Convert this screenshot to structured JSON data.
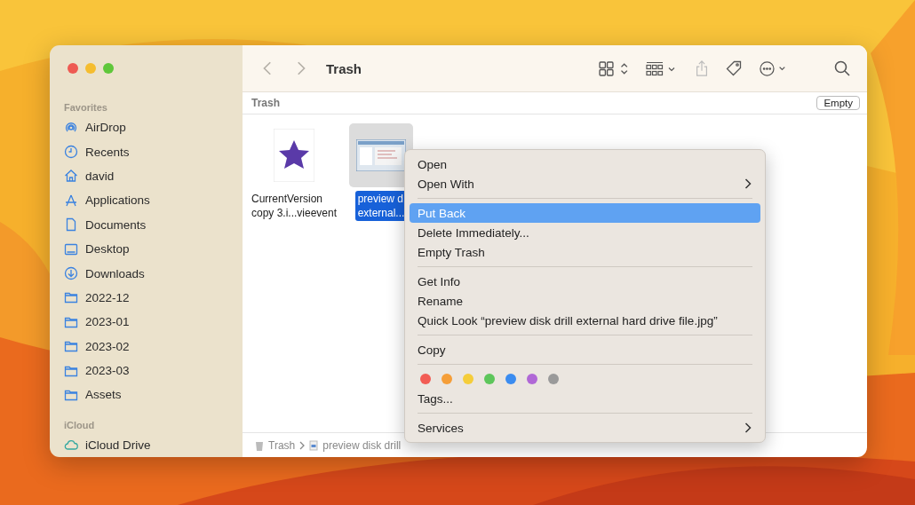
{
  "window": {
    "title": "Trash"
  },
  "sidebar": {
    "sections": [
      {
        "heading": "Favorites",
        "items": [
          {
            "label": "AirDrop",
            "kind": "airdrop"
          },
          {
            "label": "Recents",
            "kind": "clock"
          },
          {
            "label": "david",
            "kind": "home"
          },
          {
            "label": "Applications",
            "kind": "apps"
          },
          {
            "label": "Documents",
            "kind": "doc"
          },
          {
            "label": "Desktop",
            "kind": "desktop"
          },
          {
            "label": "Downloads",
            "kind": "download"
          },
          {
            "label": "2022-12",
            "kind": "folder"
          },
          {
            "label": "2023-01",
            "kind": "folder"
          },
          {
            "label": "2023-02",
            "kind": "folder"
          },
          {
            "label": "2023-03",
            "kind": "folder"
          },
          {
            "label": "Assets",
            "kind": "folder"
          }
        ]
      },
      {
        "heading": "iCloud",
        "items": [
          {
            "label": "iCloud Drive",
            "kind": "cloud"
          }
        ]
      }
    ]
  },
  "location_bar": {
    "title": "Trash",
    "button": "Empty"
  },
  "files": [
    {
      "kind": "star",
      "lines": [
        "CurrentVersion",
        "copy 3.i...vieevent"
      ],
      "selected": false
    },
    {
      "kind": "screenshot",
      "lines": [
        "preview d",
        "external..."
      ],
      "selected": true
    }
  ],
  "path_bar": [
    "Trash",
    "preview disk drill"
  ],
  "context_menu": {
    "groups": [
      [
        {
          "label": "Open",
          "submenu": false,
          "selected": false
        },
        {
          "label": "Open With",
          "submenu": true,
          "selected": false
        }
      ],
      [
        {
          "label": "Put Back",
          "submenu": false,
          "selected": true
        },
        {
          "label": "Delete Immediately...",
          "submenu": false,
          "selected": false
        },
        {
          "label": "Empty Trash",
          "submenu": false,
          "selected": false
        }
      ],
      [
        {
          "label": "Get Info",
          "submenu": false,
          "selected": false
        },
        {
          "label": "Rename",
          "submenu": false,
          "selected": false
        },
        {
          "label": "Quick Look “preview disk drill external hard drive file.jpg”",
          "submenu": false,
          "selected": false
        }
      ],
      [
        {
          "label": "Copy",
          "submenu": false,
          "selected": false
        }
      ]
    ],
    "tag_colors": [
      {
        "color": "#f25c54"
      },
      {
        "color": "#f59e38"
      },
      {
        "color": "#f5cd3a"
      },
      {
        "color": "#5dc65b"
      },
      {
        "color": "#3b8cf0"
      },
      {
        "color": "#b068d6"
      },
      {
        "color": "#9a9a9a"
      }
    ],
    "tags_item": "Tags...",
    "services": {
      "label": "Services",
      "submenu": true
    }
  }
}
